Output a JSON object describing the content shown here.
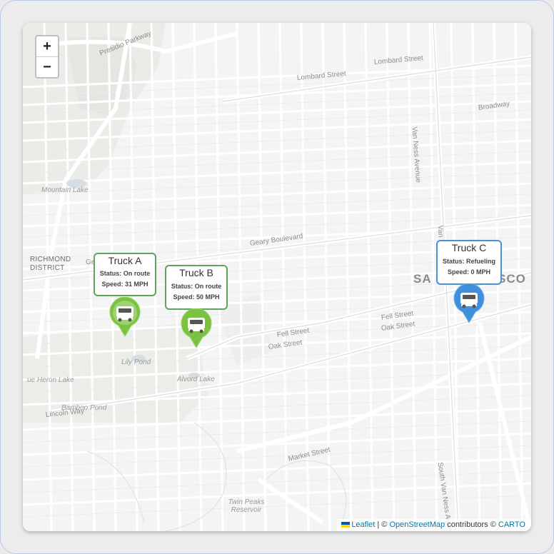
{
  "zoom": {
    "in_label": "+",
    "out_label": "−"
  },
  "labels": {
    "presidio": "Presidio Parkway",
    "lombard1": "Lombard Street",
    "lombard2": "Lombard Street",
    "van_ness": "Van Ness Avenue",
    "van_ness2": "Van Ness",
    "broadway": "Broadway",
    "mountain_lake": "Mountain Lake",
    "richmond": "Richmond District",
    "geary": "Geary Boulevard",
    "ge": "Ge",
    "fell1": "Fell Street",
    "oak1": "Oak Street",
    "fell2": "Fell Street",
    "oak2": "Oak Street",
    "city_left": "SA",
    "city_right": "SCO",
    "lily": "Lily Pond",
    "blue_heron": "ue Heron Lake",
    "alvord": "Alvord Lake",
    "bamboo": "Bamboo Pond",
    "lincoln": "Lincoln Way",
    "market": "Market Street",
    "twin_peaks": "Twin Peaks Reservoir",
    "south_van_ness": "South Van Ness Avenue"
  },
  "vehicles": [
    {
      "name": "Truck A",
      "status": "Status: On route",
      "speed": "Speed: 31 MPH",
      "color": "#5fa35f",
      "pin_color": "#7cc242"
    },
    {
      "name": "Truck B",
      "status": "Status: On route",
      "speed": "Speed: 50 MPH",
      "color": "#5fa35f",
      "pin_color": "#7cc242"
    },
    {
      "name": "Truck C",
      "status": "Status: Refueling",
      "speed": "Speed: 0 MPH",
      "color": "#4a90d9",
      "pin_color": "#3f8fde"
    }
  ],
  "attribution": {
    "leaflet": "Leaflet",
    "sep": " | © ",
    "osm": "OpenStreetMap",
    "contrib": " contributors © ",
    "carto": "CARTO"
  }
}
